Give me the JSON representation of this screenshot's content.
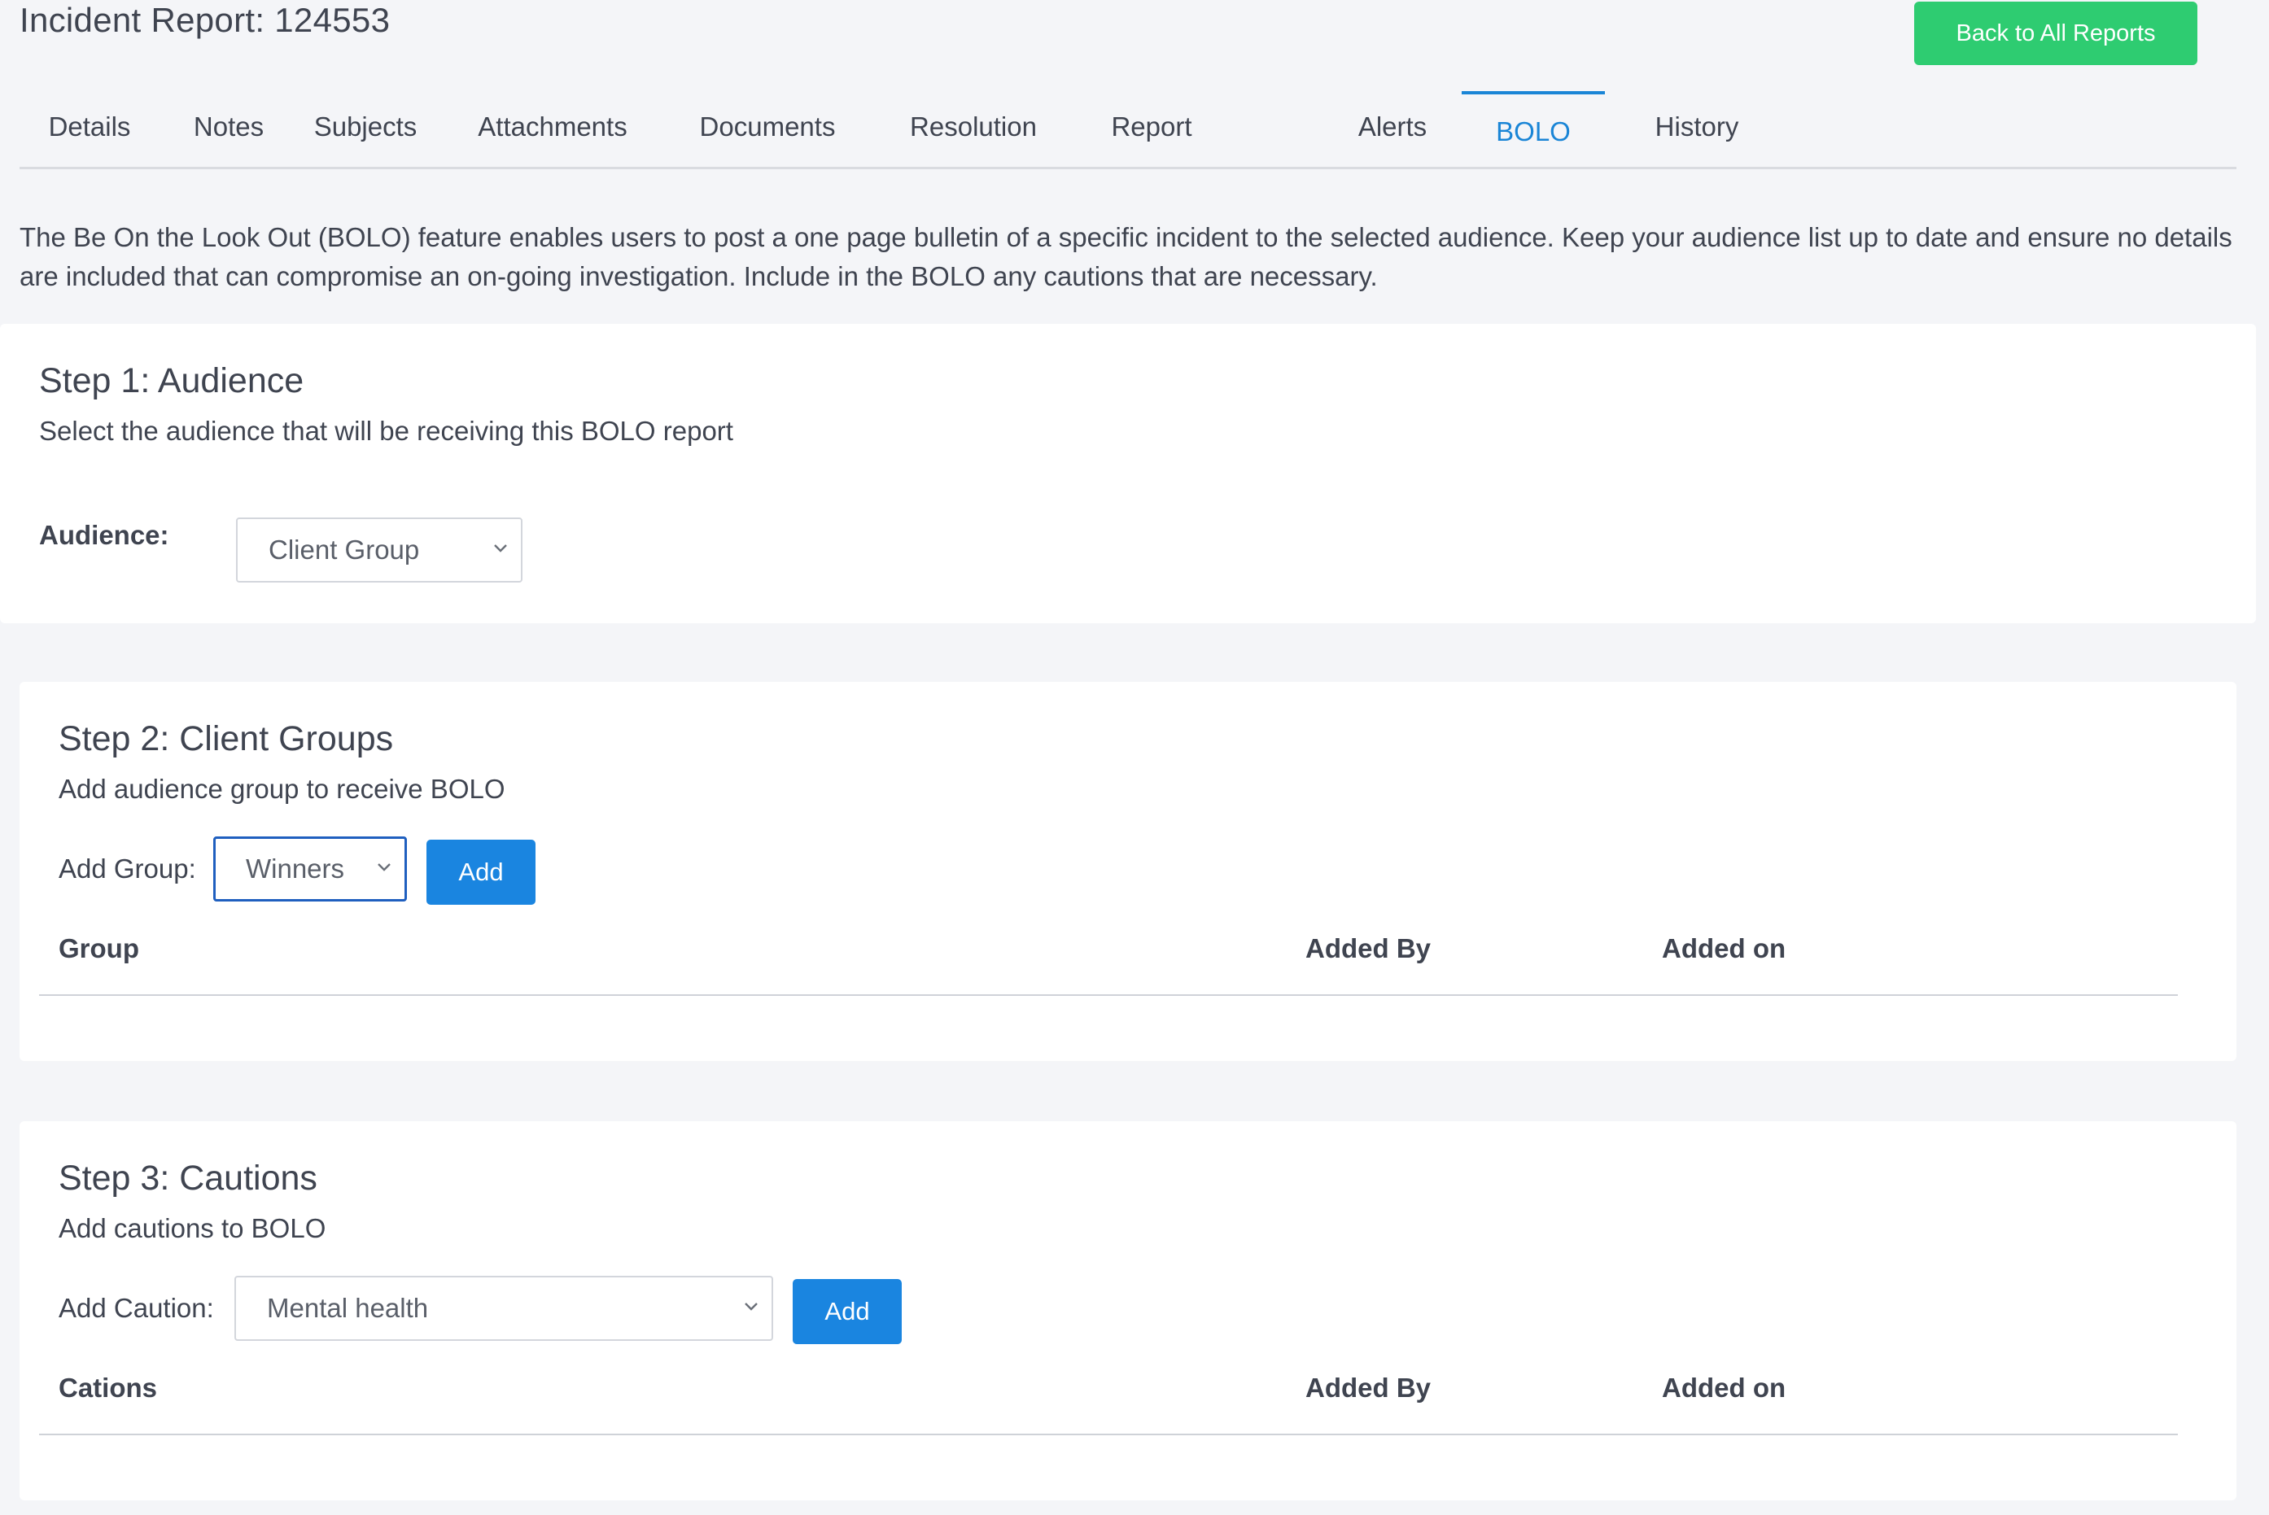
{
  "header": {
    "title": "Incident Report: 124553",
    "back_button": "Back to All Reports"
  },
  "tabs": [
    {
      "label": "Details",
      "active": false
    },
    {
      "label": "Notes",
      "active": false
    },
    {
      "label": "Subjects",
      "active": false
    },
    {
      "label": "Attachments",
      "active": false
    },
    {
      "label": "Documents",
      "active": false
    },
    {
      "label": "Resolution",
      "active": false
    },
    {
      "label": "Report",
      "active": false
    },
    {
      "label": "Alerts",
      "active": false
    },
    {
      "label": "BOLO",
      "active": true
    },
    {
      "label": "History",
      "active": false
    }
  ],
  "intro": "The Be On the Look Out (BOLO) feature enables users to post a one page bulletin of a specific incident to the selected audience. Keep your audience list up to date and ensure no details are included that can compromise an on-going investigation. Include in the BOLO any cautions that are necessary.",
  "step1": {
    "title": "Step 1: Audience",
    "subtitle": "Select the audience that will be receiving this BOLO report",
    "field_label": "Audience:",
    "selected": "Client Group"
  },
  "step2": {
    "title": "Step 2: Client Groups",
    "subtitle": "Add audience group to receive BOLO",
    "field_label": "Add Group:",
    "selected": "Winners",
    "add_button": "Add",
    "columns": [
      "Group",
      "Added By",
      "Added on"
    ]
  },
  "step3": {
    "title": "Step 3: Cautions",
    "subtitle": "Add cautions to BOLO",
    "field_label": "Add Caution:",
    "selected": "Mental health",
    "add_button": "Add",
    "columns": [
      "Cations",
      "Added By",
      "Added on"
    ]
  },
  "colors": {
    "accent": "#1a85d6",
    "success": "#2ecc71",
    "background": "#f4f5f8",
    "text": "#3f4450"
  }
}
